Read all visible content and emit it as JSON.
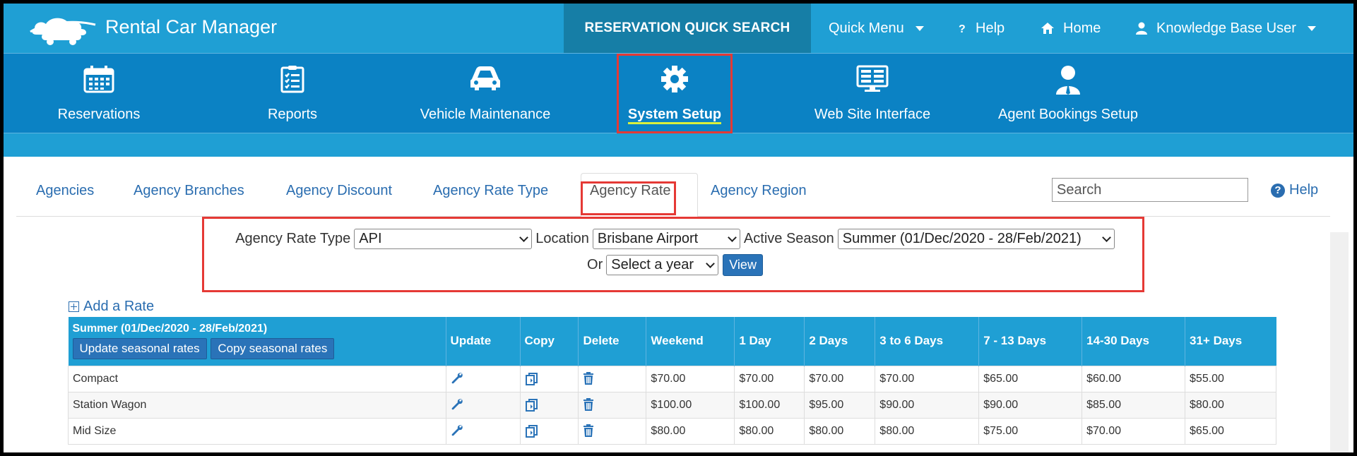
{
  "header": {
    "app_title": "Rental Car Manager",
    "quick_search": "RESERVATION QUICK SEARCH",
    "quick_menu": "Quick Menu",
    "help": "Help",
    "home": "Home",
    "user": "Knowledge Base User"
  },
  "modules": [
    {
      "label": "Reservations",
      "icon": "calendar-icon"
    },
    {
      "label": "Reports",
      "icon": "clipboard-checklist-icon"
    },
    {
      "label": "Vehicle Maintenance",
      "icon": "car-icon"
    },
    {
      "label": "System Setup",
      "icon": "gear-icon",
      "active": true
    },
    {
      "label": "Web Site Interface",
      "icon": "monitor-icon"
    },
    {
      "label": "Agent Bookings Setup",
      "icon": "agent-icon"
    }
  ],
  "tabs": [
    {
      "label": "Agencies"
    },
    {
      "label": "Agency Branches"
    },
    {
      "label": "Agency Discount"
    },
    {
      "label": "Agency Rate Type"
    },
    {
      "label": "Agency Rate",
      "active": true
    },
    {
      "label": "Agency Region"
    }
  ],
  "search": {
    "placeholder": "Search"
  },
  "help_link": "Help",
  "filters": {
    "rate_type_label": "Agency Rate Type",
    "rate_type_value": "API",
    "location_label": "Location",
    "location_value": "Brisbane Airport",
    "season_label": "Active Season",
    "season_value": "Summer (01/Dec/2020 - 28/Feb/2021)",
    "or_label": "Or",
    "year_value": "Select a year",
    "view_button": "View"
  },
  "add_rate": "Add a Rate",
  "table": {
    "season_title": "Summer (01/Dec/2020 - 28/Feb/2021)",
    "update_seasonal": "Update seasonal rates",
    "copy_seasonal": "Copy seasonal rates",
    "headers": [
      "Update",
      "Copy",
      "Delete",
      "Weekend",
      "1 Day",
      "2 Days",
      "3 to 6 Days",
      "7 - 13 Days",
      "14-30 Days",
      "31+ Days"
    ],
    "rows": [
      {
        "name": "Compact",
        "rates": [
          "$70.00",
          "$70.00",
          "$70.00",
          "$70.00",
          "$65.00",
          "$60.00",
          "$55.00"
        ]
      },
      {
        "name": "Station Wagon",
        "rates": [
          "$100.00",
          "$100.00",
          "$95.00",
          "$90.00",
          "$90.00",
          "$85.00",
          "$80.00"
        ]
      },
      {
        "name": "Mid Size",
        "rates": [
          "$80.00",
          "$80.00",
          "$80.00",
          "$80.00",
          "$75.00",
          "$70.00",
          "$65.00"
        ]
      }
    ]
  },
  "colors": {
    "header_blue": "#1f9fd4",
    "module_blue": "#0b82c4",
    "quick_search_bg": "#167ea6",
    "highlight_red": "#e53935",
    "link_blue": "#2a6db0"
  }
}
